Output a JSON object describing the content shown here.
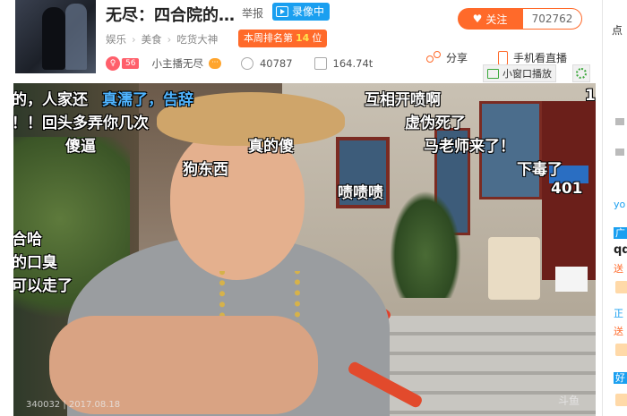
{
  "header": {
    "title": "无尽：四合院的…",
    "report_label": "举报",
    "record_badge": "录像中",
    "breadcrumb": [
      "娱乐",
      "美食",
      "吃货大神"
    ],
    "rank": {
      "prefix": "本周排名第",
      "number": "14",
      "suffix": "位"
    },
    "follow_label": "关注",
    "follow_count": "702762",
    "owner": {
      "level": "56",
      "name": "小主播无尽"
    },
    "stats": {
      "popularity": "40787",
      "weight": "164.74t"
    },
    "share_label": "分享",
    "mobile_label": "手机看直播",
    "mini_window_label": "小窗口播放"
  },
  "video": {
    "danmu": [
      {
        "text": "的，人家还",
        "blue": false
      },
      {
        "text": "真濡了，告辞",
        "blue": true
      },
      {
        "text": "互相开喷啊",
        "blue": false
      },
      {
        "text": "！！回头多弄你几次",
        "blue": false
      },
      {
        "text": "虚伪死了",
        "blue": false
      },
      {
        "text": "傻逼",
        "blue": false
      },
      {
        "text": "真的傻",
        "blue": false
      },
      {
        "text": "马老师来了！",
        "blue": false
      },
      {
        "text": "狗东西",
        "blue": false
      },
      {
        "text": "下毒了",
        "blue": false
      },
      {
        "text": "啧啧啧",
        "blue": false
      },
      {
        "text": "401",
        "blue": false
      },
      {
        "text": "合哈",
        "blue": false
      },
      {
        "text": "的口臭",
        "blue": false
      },
      {
        "text": "可以走了",
        "blue": false
      },
      {
        "text": "1",
        "blue": false
      }
    ],
    "timestamp": "340032 | 2017.08.18",
    "watermark": "斗鱼"
  },
  "sidebar": {
    "top_label": "点",
    "items": [
      {
        "text": "yo",
        "color": "#1a9ff0"
      },
      {
        "text": "广",
        "color": "#1a9ff0"
      },
      {
        "text": "qq",
        "color": "#222222"
      },
      {
        "text": "送",
        "color": "#ff6a2a"
      },
      {
        "text": "正",
        "color": "#1a9ff0"
      },
      {
        "text": "送",
        "color": "#ff6a2a"
      },
      {
        "text": "好",
        "color": "#1a9ff0"
      }
    ]
  },
  "colors": {
    "accent": "#ff6a2a",
    "blue": "#1a9ff0",
    "green": "#3aa83a"
  }
}
